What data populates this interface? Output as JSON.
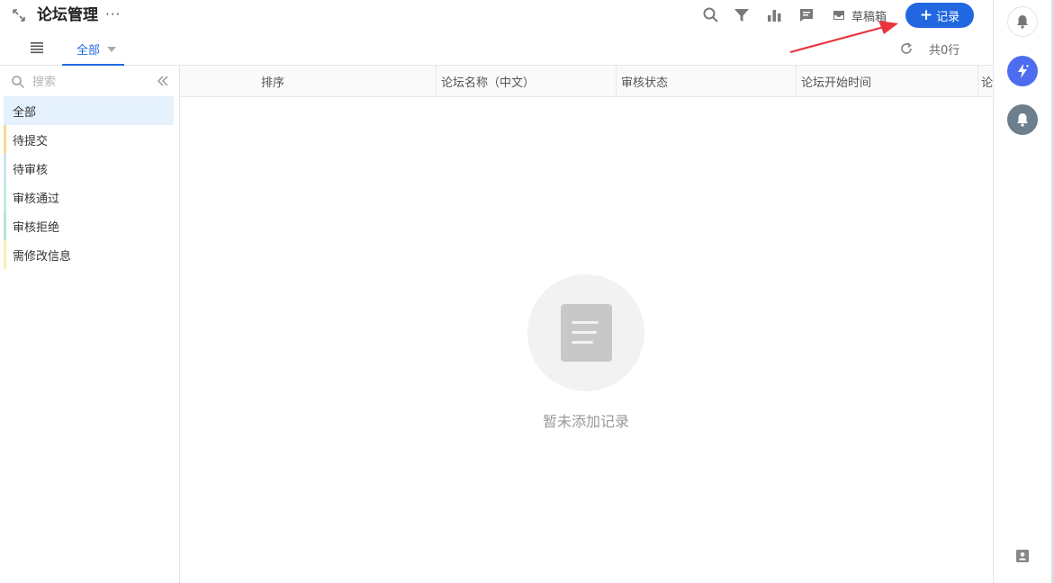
{
  "header": {
    "title": "论坛管理",
    "more": "···",
    "draft_label": "草稿箱",
    "add_label": "记录",
    "add_plus": "+",
    "accent": "#2168e0"
  },
  "view": {
    "tab_label": "全部",
    "row_count": "共0行"
  },
  "sidebar": {
    "search_placeholder": "搜索",
    "items": [
      {
        "label": "全部",
        "color": "transparent",
        "active": true
      },
      {
        "label": "待提交",
        "color": "#f6d991"
      },
      {
        "label": "待审核",
        "color": "#c9e6f2"
      },
      {
        "label": "审核通过",
        "color": "#c2ecd9"
      },
      {
        "label": "审核拒绝",
        "color": "#b9e6cc"
      },
      {
        "label": "需修改信息",
        "color": "#fbefb0"
      }
    ]
  },
  "table": {
    "columns": [
      "排序",
      "论坛名称（中文）",
      "审核状态",
      "论坛开始时间",
      "论"
    ]
  },
  "empty": {
    "message": "暂未添加记录"
  }
}
